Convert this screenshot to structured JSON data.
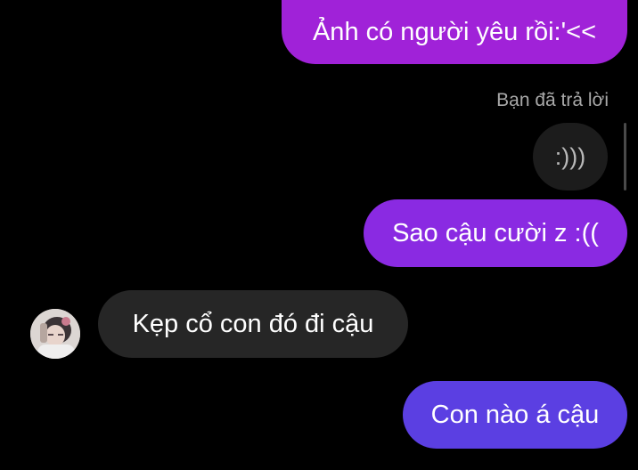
{
  "messages": [
    {
      "id": "msg1",
      "sender": "me",
      "text": "Ảnh có người yêu rồi:'<<"
    },
    {
      "id": "msg2",
      "sender": "me",
      "text": "Sao cậu cười z :(("
    },
    {
      "id": "msg3",
      "sender": "them",
      "text": "Kẹp cổ con đó đi cậu"
    },
    {
      "id": "msg4",
      "sender": "me",
      "text": "Con nào á cậu"
    }
  ],
  "reply": {
    "label": "Bạn đã trả lời",
    "quoted_text": ":)))"
  },
  "colors": {
    "background": "#000000",
    "bubble_purple": "#a022d8",
    "bubble_violet": "#8a2ae2",
    "bubble_indigo": "#5b3fe2",
    "bubble_incoming": "#262626",
    "quote_bubble": "#1c1c1c"
  },
  "icons": {
    "avatar": "user-avatar"
  }
}
